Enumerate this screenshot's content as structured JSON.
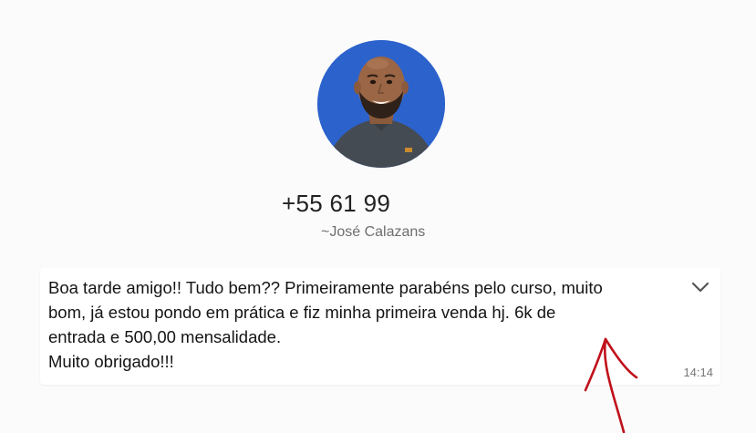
{
  "contact": {
    "avatar_icon": "contact-photo",
    "phone": "+55 61 99",
    "name": "~José Calazans"
  },
  "message": {
    "text": "Boa tarde amigo!! Tudo bem?? Primeiramente parabéns pelo curso, muito\nbom, já estou pondo em prática e fiz minha primeira venda hj. 6k de\nentrada e 500,00 mensalidade.\nMuito obrigado!!!",
    "time": "14:14",
    "menu_icon": "chevron-down-icon"
  },
  "annotation": {
    "icon": "arrow-up-icon",
    "color": "#c0101a"
  },
  "colors": {
    "avatar_background": "#2c62cc",
    "bubble_background": "#ffffff",
    "page_background": "#fbfbfb"
  }
}
